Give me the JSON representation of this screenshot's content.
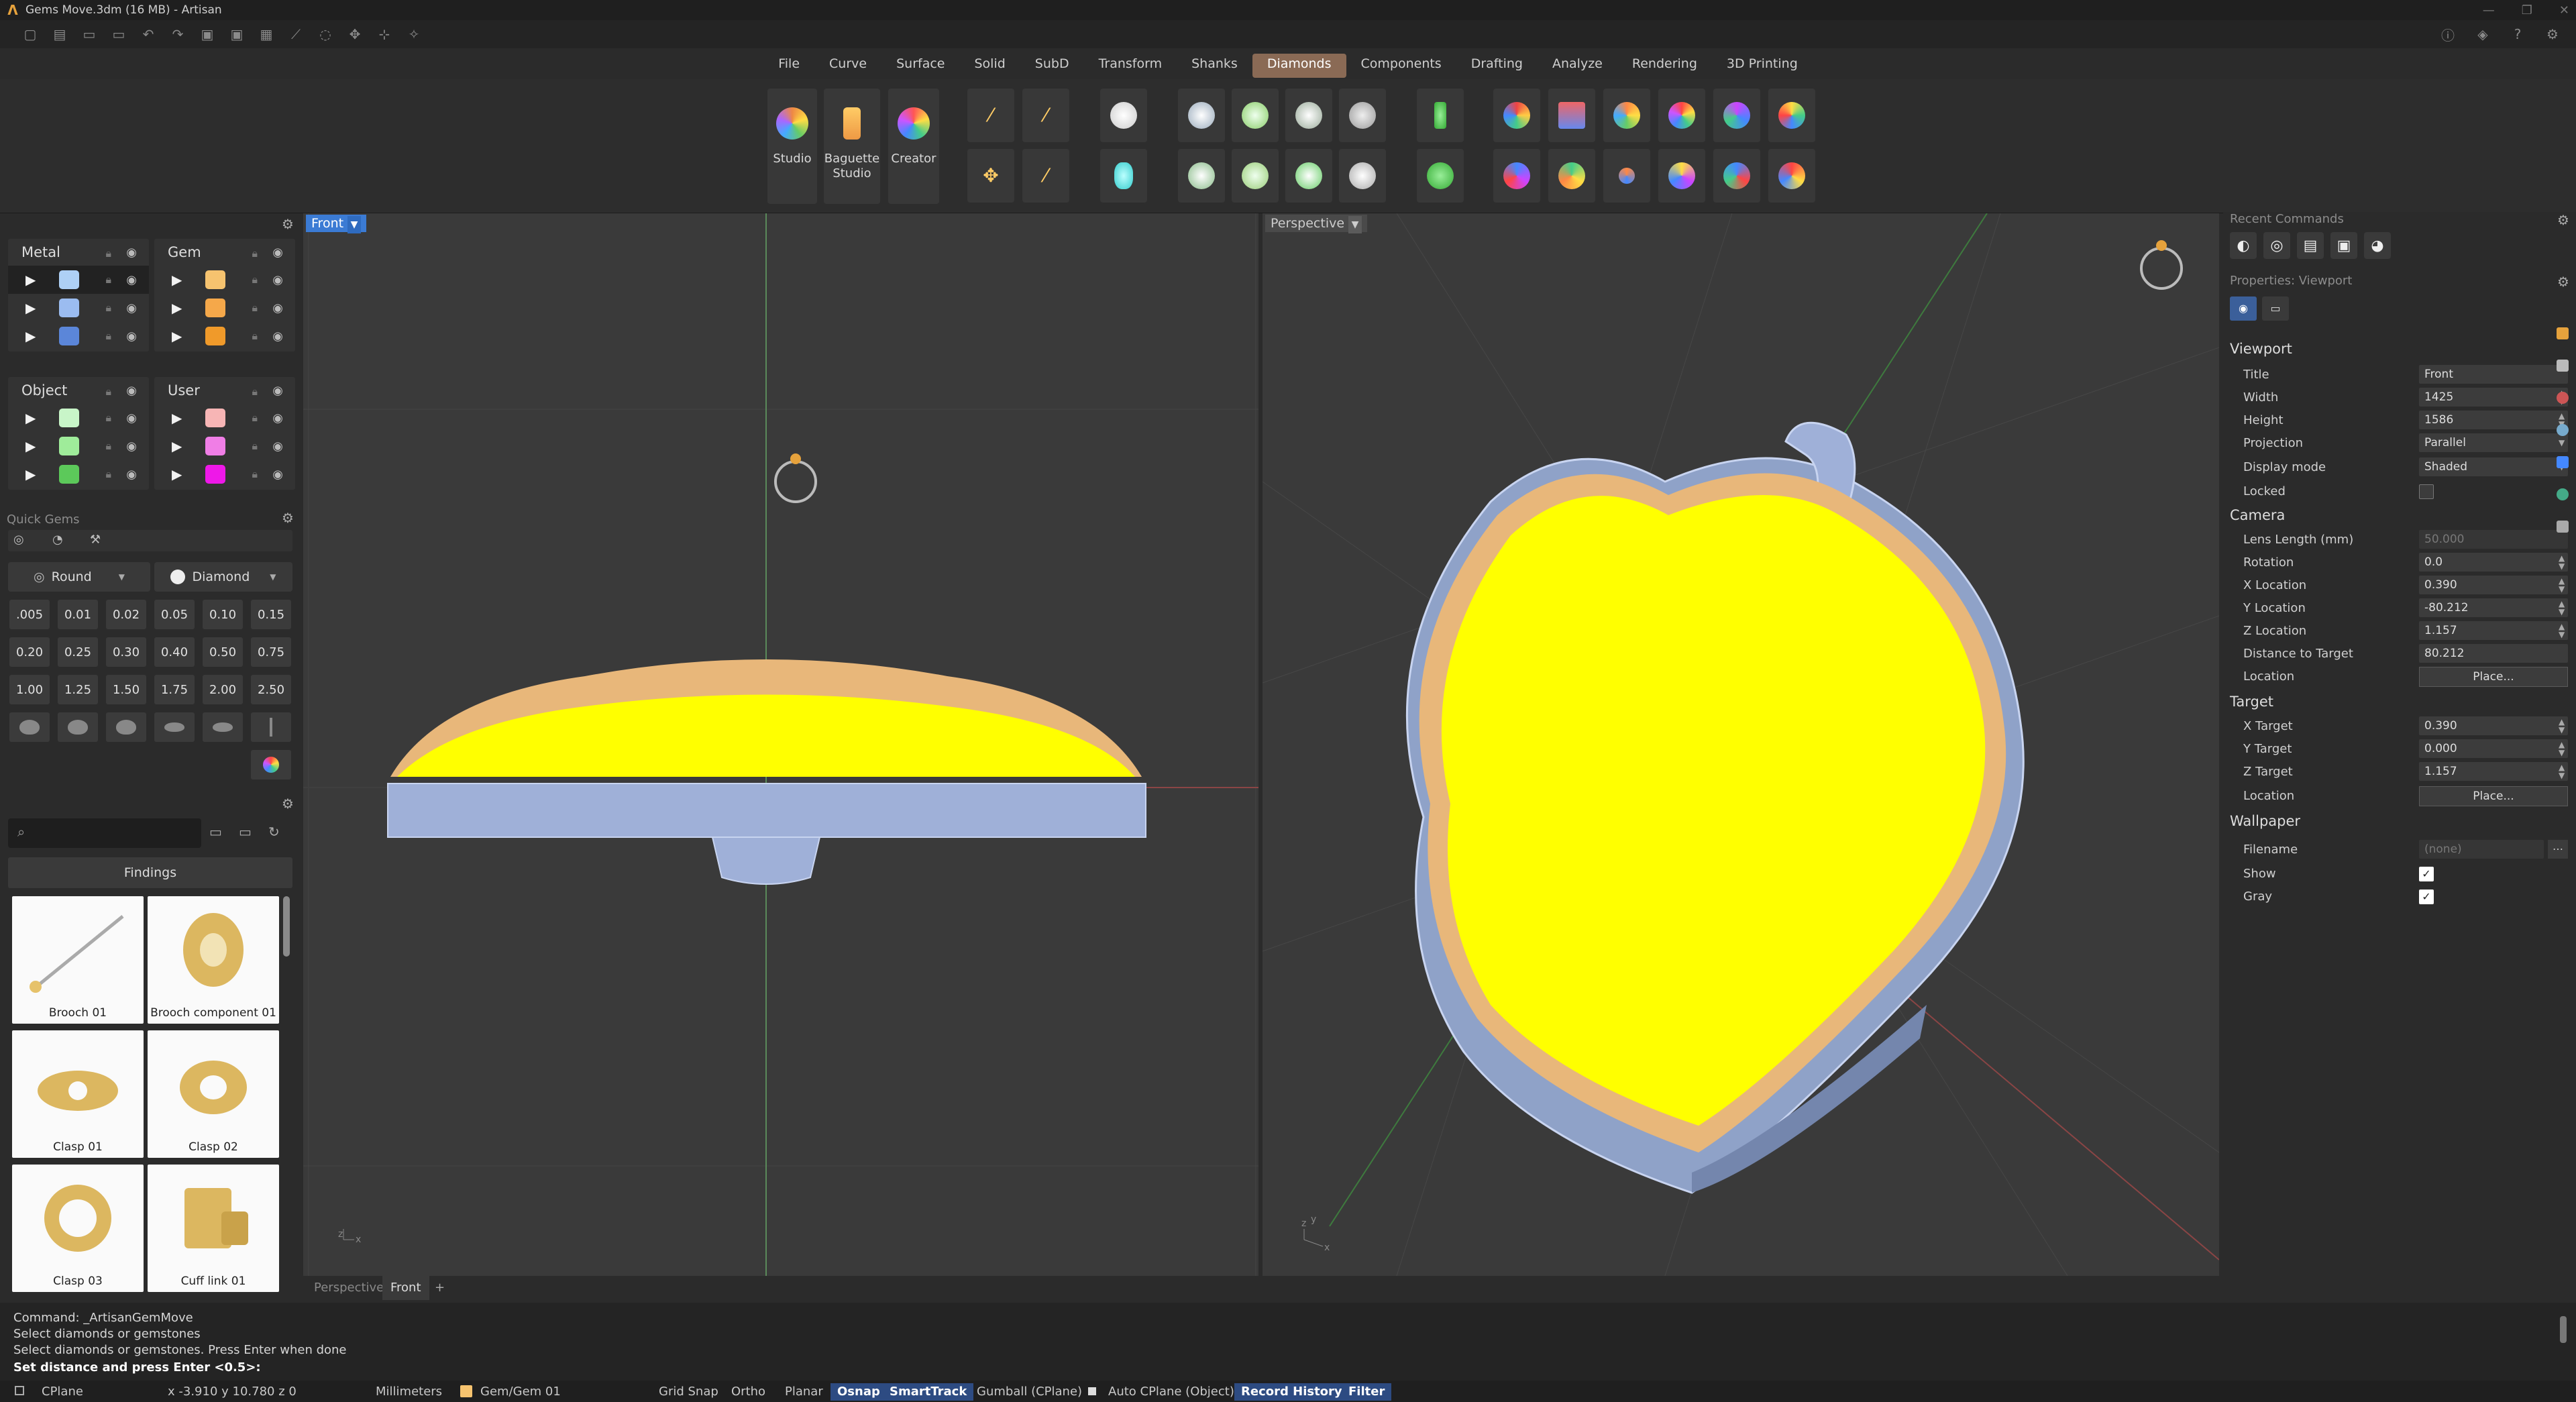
{
  "window": {
    "title": "Gems Move.3dm (16 MB) - Artisan"
  },
  "menu": [
    "File",
    "Curve",
    "Surface",
    "Solid",
    "SubD",
    "Transform",
    "Shanks",
    "Diamonds",
    "Components",
    "Drafting",
    "Analyze",
    "Rendering",
    "3D Printing"
  ],
  "menu_active": "Diamonds",
  "ribbon": {
    "studio": "Studio",
    "baguette": "Baguette",
    "baguette2": "Studio",
    "creator": "Creator"
  },
  "layers": {
    "metal": {
      "name": "Metal",
      "colors": [
        "#aed0f5",
        "#9bbcf0",
        "#5b86d9"
      ]
    },
    "gem": {
      "name": "Gem",
      "colors": [
        "#f6c36f",
        "#f5a84a",
        "#f09a2a"
      ]
    },
    "object": {
      "name": "Object",
      "colors": [
        "#c8f5c8",
        "#9fec9a",
        "#5cc95a"
      ]
    },
    "user": {
      "name": "User",
      "colors": [
        "#f7b5b5",
        "#f07ee6",
        "#ee18e8"
      ]
    }
  },
  "quick_gems": {
    "title": "Quick Gems",
    "shape": "Round",
    "material": "Diamond",
    "sizes": [
      ".005",
      "0.01",
      "0.02",
      "0.05",
      "0.10",
      "0.15",
      "0.20",
      "0.25",
      "0.30",
      "0.40",
      "0.50",
      "0.75",
      "1.00",
      "1.25",
      "1.50",
      "1.75",
      "2.00",
      "2.50"
    ]
  },
  "library": {
    "category": "Findings",
    "items": [
      "Brooch 01",
      "Brooch component 01",
      "Clasp 01",
      "Clasp 02",
      "Clasp 03",
      "Cuff link 01"
    ]
  },
  "viewports": {
    "front": "Front",
    "perspective": "Perspective"
  },
  "bottom_tabs": [
    "Perspective",
    "Front"
  ],
  "add_tab": "+",
  "right_panel": {
    "recent": "Recent Commands",
    "props_title": "Properties: Viewport",
    "viewport_section": "Viewport",
    "title_label": "Title",
    "title_val": "Front",
    "width_label": "Width",
    "width_val": "1425",
    "height_label": "Height",
    "height_val": "1586",
    "projection_label": "Projection",
    "projection_val": "Parallel",
    "display_label": "Display mode",
    "display_val": "Shaded",
    "locked_label": "Locked",
    "camera_section": "Camera",
    "lens_label": "Lens Length (mm)",
    "lens_val": "50.000",
    "rotation_label": "Rotation",
    "rotation_val": "0.0",
    "xloc_label": "X Location",
    "xloc_val": "0.390",
    "yloc_label": "Y Location",
    "yloc_val": "-80.212",
    "zloc_label": "Z Location",
    "zloc_val": "1.157",
    "dist_label": "Distance to Target",
    "dist_val": "80.212",
    "loc_label": "Location",
    "place": "Place...",
    "target_section": "Target",
    "xt_label": "X Target",
    "xt_val": "0.390",
    "yt_label": "Y Target",
    "yt_val": "0.000",
    "zt_label": "Z Target",
    "zt_val": "1.157",
    "tloc_label": "Location",
    "wall_section": "Wallpaper",
    "file_label": "Filename",
    "file_val": "(none)",
    "show_label": "Show",
    "gray_label": "Gray",
    "check": "✓"
  },
  "command": {
    "lines": [
      "Command: _ArtisanGemMove",
      "Select diamonds or gemstones",
      "Select diamonds or gemstones. Press Enter when done"
    ],
    "prompt": "Set distance and press Enter <0.5>:"
  },
  "status": {
    "cplane": "CPlane",
    "coords": "x -3.910  y 10.780  z 0",
    "units": "Millimeters",
    "layer": "Gem/Gem 01",
    "grid": "Grid Snap",
    "ortho": "Ortho",
    "planar": "Planar",
    "osnap": "Osnap",
    "smarttrack": "SmartTrack",
    "gumball": "Gumball (CPlane)",
    "autocplane": "Auto CPlane (Object)",
    "history": "Record History",
    "filter": "Filter"
  }
}
